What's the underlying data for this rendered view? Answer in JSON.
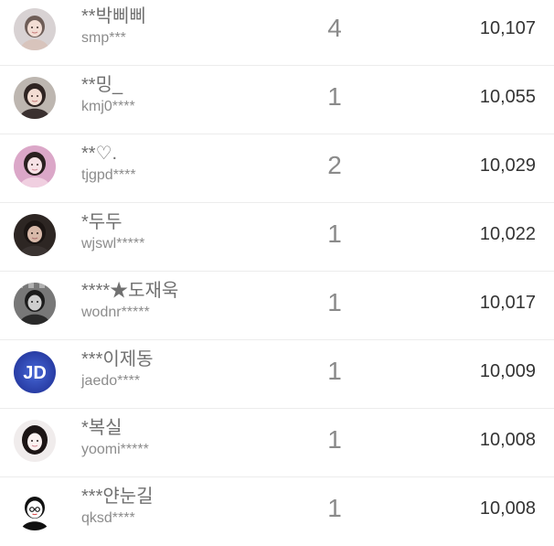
{
  "rows": [
    {
      "name": "**박삐삐",
      "uid": "smp***",
      "count": "4",
      "points": "10,107",
      "avatar_icon": "profile-photo-icon",
      "avatar_bg": "#c9c2c4",
      "avatar_fg": "#f2d9d0"
    },
    {
      "name": "**밍_",
      "uid": "kmj0****",
      "count": "1",
      "points": "10,055",
      "avatar_icon": "profile-photo-icon",
      "avatar_bg": "#b9b3ad",
      "avatar_fg": "#f3dcd2"
    },
    {
      "name": "**♡.",
      "uid": "tjgpd****",
      "count": "2",
      "points": "10,029",
      "avatar_icon": "profile-photo-icon",
      "avatar_bg": "#d89bc2",
      "avatar_fg": "#f6dfe6"
    },
    {
      "name": "*두두",
      "uid": "wjswl*****",
      "count": "1",
      "points": "10,022",
      "avatar_icon": "profile-photo-icon",
      "avatar_bg": "#2e2723",
      "avatar_fg": "#d8b9a9"
    },
    {
      "name": "****★도재욱",
      "uid": "wodnr*****",
      "count": "1",
      "points": "10,017",
      "avatar_icon": "profile-photo-icon",
      "avatar_bg": "#6f6f6f",
      "avatar_fg": "#cccccc"
    },
    {
      "name": "***이제동",
      "uid": "jaedo****",
      "count": "1",
      "points": "10,009",
      "avatar_icon": "jd-logo-icon",
      "avatar_bg": "#2f4fb6",
      "avatar_fg": "#ffffff",
      "avatar_text": "JD"
    },
    {
      "name": "*복실",
      "uid": "yoomi*****",
      "count": "1",
      "points": "10,008",
      "avatar_icon": "profile-photo-icon",
      "avatar_bg": "#ece7e6",
      "avatar_fg": "#2a2323"
    },
    {
      "name": "***얀눈길",
      "uid": "qksd****",
      "count": "1",
      "points": "10,008",
      "avatar_icon": "cartoon-boy-icon",
      "avatar_bg": "#ffffff",
      "avatar_fg": "#111111"
    }
  ]
}
